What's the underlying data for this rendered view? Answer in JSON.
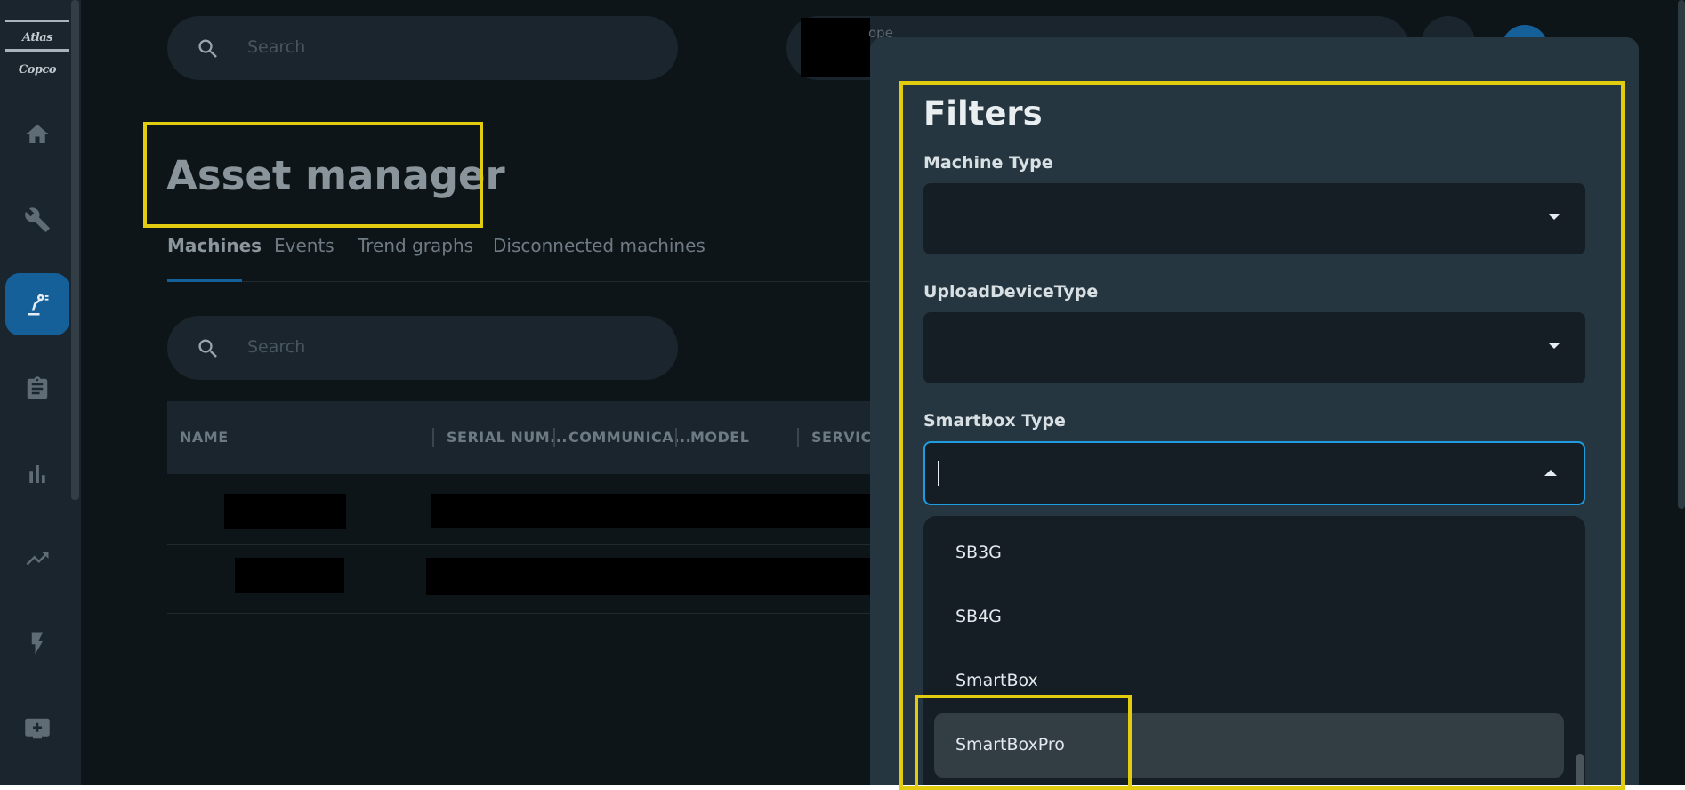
{
  "sidebar": {
    "logo_text": "Atlas Copco",
    "items": [
      {
        "name": "home-icon",
        "active": false
      },
      {
        "name": "wrench-icon",
        "active": false
      },
      {
        "name": "robot-arm-icon",
        "active": true
      },
      {
        "name": "clipboard-icon",
        "active": false
      },
      {
        "name": "bar-chart-icon",
        "active": false
      },
      {
        "name": "trending-up-icon",
        "active": false
      },
      {
        "name": "lightning-icon",
        "active": false
      },
      {
        "name": "monitor-add-icon",
        "active": false
      }
    ]
  },
  "header": {
    "search_placeholder": "Search",
    "scope_label": "ope"
  },
  "main": {
    "title": "Asset manager",
    "tabs": [
      {
        "label": "Machines",
        "active": true
      },
      {
        "label": "Events",
        "active": false
      },
      {
        "label": "Trend graphs",
        "active": false
      },
      {
        "label": "Disconnected machines",
        "active": false
      }
    ],
    "search_placeholder": "Search",
    "table": {
      "columns": [
        "NAME",
        "SERIAL NUM...",
        "COMMUNICA...",
        "MODEL",
        "SERVICE"
      ]
    }
  },
  "filters": {
    "title": "Filters",
    "machine_type_label": "Machine Type",
    "upload_device_type_label": "UploadDeviceType",
    "smartbox_type_label": "Smartbox Type",
    "smartbox_options": [
      "SB3G",
      "SB4G",
      "SmartBox",
      "SmartBoxPro"
    ],
    "highlighted_option": "SmartBoxPro"
  },
  "colors": {
    "accent": "#16609a",
    "focus_border": "#1f9be0",
    "annotation": "#e2cc10"
  }
}
